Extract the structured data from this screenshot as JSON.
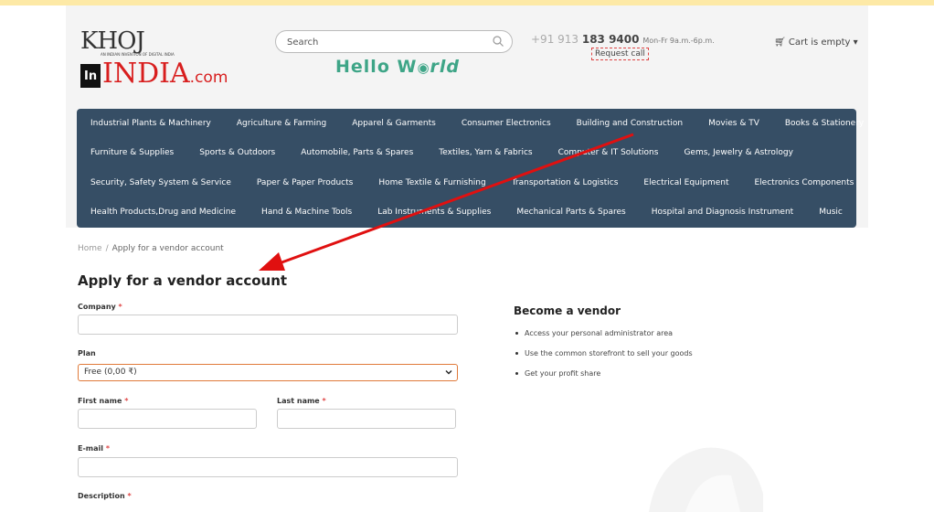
{
  "header": {
    "logo": {
      "line1": "KHOJ",
      "tagline": "AN INDIAN INVENTION OF DIGITAL INDIA",
      "line2": "INDIA",
      "suffix": ".com",
      "badge": "In"
    },
    "search_placeholder": "Search",
    "hello_text_1": "Hello W",
    "hello_text_2": "rld",
    "phone_prefix": "+91 913 ",
    "phone_main": "183 9400",
    "phone_hours": "Mon-Fr 9a.m.-6p.m.",
    "request_call": "Request call",
    "cart": "Cart is empty"
  },
  "nav": {
    "rows": [
      [
        "Industrial Plants & Machinery",
        "Agriculture & Farming",
        "Apparel & Garments",
        "Consumer Electronics",
        "Building and Construction",
        "Movies & TV",
        "Books & Stationery"
      ],
      [
        "Furniture & Supplies",
        "Sports & Outdoors",
        "Automobile, Parts & Spares",
        "Textiles, Yarn & Fabrics",
        "Computer & IT Solutions",
        "Gems, Jewelry & Astrology"
      ],
      [
        "Security, Safety System & Service",
        "Paper & Paper Products",
        "Home Textile & Furnishing",
        "Transportation & Logistics",
        "Electrical Equipment",
        "Electronics Components"
      ],
      [
        "Health Products,Drug and Medicine",
        "Hand & Machine Tools",
        "Lab Instruments & Supplies",
        "Mechanical Parts & Spares",
        "Hospital and Diagnosis Instrument",
        "Music"
      ]
    ]
  },
  "breadcrumb": {
    "home": "Home",
    "sep": "/",
    "current": "Apply for a vendor account"
  },
  "form": {
    "title": "Apply for a vendor account",
    "company_label": "Company",
    "plan_label": "Plan",
    "plan_value": "Free (0,00 ₹)",
    "first_name_label": "First name",
    "last_name_label": "Last name",
    "email_label": "E-mail",
    "description_label": "Description",
    "required_mark": "*"
  },
  "vendor": {
    "title": "Become a vendor",
    "points": [
      "Access your personal administrator area",
      "Use the common storefront to sell your goods",
      "Get your profit share"
    ]
  },
  "colors": {
    "nav_bg": "#364e65",
    "accent": "#e07a3a",
    "hello": "#3ea587",
    "arrow": "#e01010"
  }
}
